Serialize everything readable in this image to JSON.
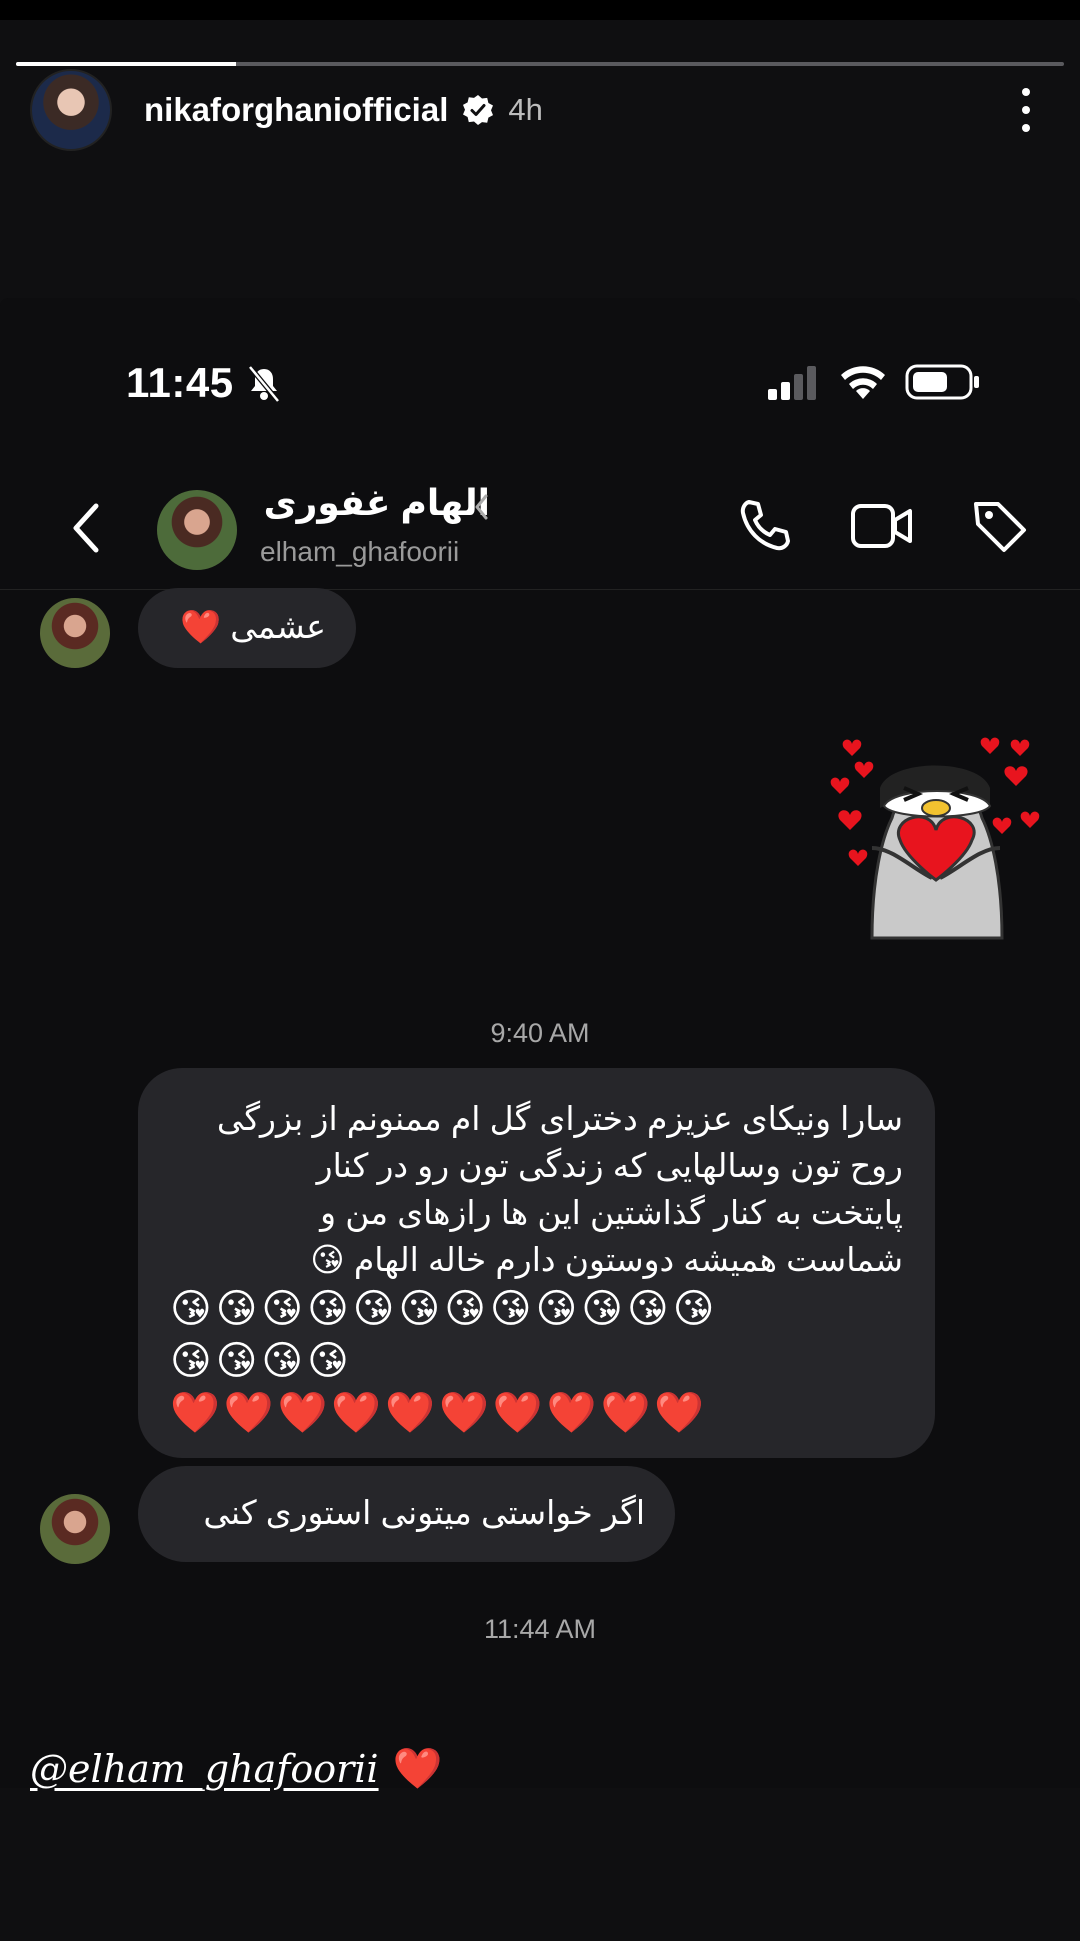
{
  "story": {
    "username": "nikaforghaniofficial",
    "time_ago": "4h",
    "progress_fraction": 0.21
  },
  "status_bar": {
    "time": "11:45"
  },
  "chat_header": {
    "contact_name": "الهام غفوری",
    "contact_handle": "elham_ghafoorii",
    "icons": [
      "back-icon",
      "chevron-right-icon",
      "phone-icon",
      "video-icon",
      "tag-icon"
    ]
  },
  "messages": [
    {
      "type": "received",
      "text": "عشمی ❤️"
    },
    {
      "type": "sent_sticker",
      "icon": "penguin-hearts-sticker"
    },
    {
      "type": "timestamp",
      "text": "9:40 AM"
    },
    {
      "type": "received",
      "lines": [
        "سارا ونیکای عزیزم دخترای گل ام ممنونم از بزرگی",
        "روح تون وسالهایی که زندگی تون رو در کنار",
        "پایتخت به کنار گذاشتین این ها رازهای من و",
        "شماست همیشه دوستون دارم     خاله الهام 😘",
        "😘😘😘😘😘😘😘😘😘😘😘😘",
        "😘😘😘😘",
        "❤️❤️❤️❤️❤️❤️❤️❤️❤️❤️"
      ]
    },
    {
      "type": "received",
      "text": "اگر خواستی میتونی استوری کنی"
    },
    {
      "type": "timestamp",
      "text": "11:44 AM"
    }
  ],
  "mention": {
    "handle": "@elham_ghafoorii",
    "heart": "❤️"
  },
  "colors": {
    "background": "#0d0d0f",
    "bubble": "#26262a",
    "heart": "#e0141e"
  }
}
